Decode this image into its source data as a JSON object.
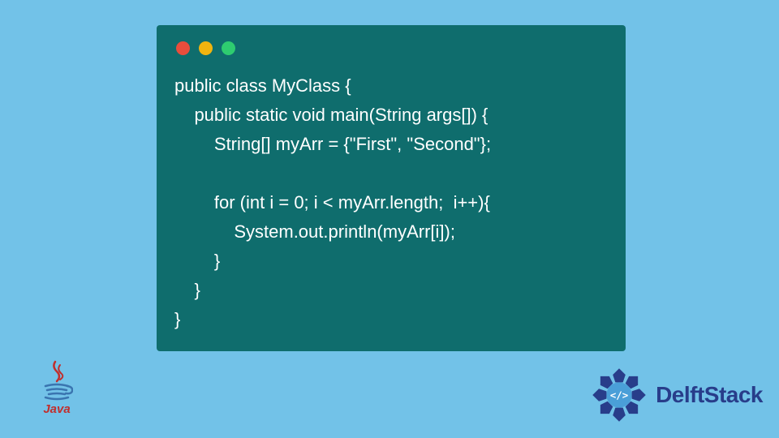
{
  "code": {
    "line1": "public class MyClass {",
    "line2": "    public static void main(String args[]) {",
    "line3": "        String[] myArr = {\"First\", \"Second\"};",
    "line4": "",
    "line5": "        for (int i = 0; i < myArr.length;  i++){",
    "line6": "            System.out.println(myArr[i]);",
    "line7": "        }",
    "line8": "    }",
    "line9": "}"
  },
  "logos": {
    "java_label": "Java",
    "delft_label": "DelftStack"
  },
  "colors": {
    "background": "#72c2e8",
    "window": "#0f6d6d",
    "text": "#ffffff",
    "red": "#e84d3c",
    "yellow": "#f1b40f",
    "green": "#2ecc70",
    "java_red": "#c02f2e",
    "delft_blue": "#283d8a"
  }
}
